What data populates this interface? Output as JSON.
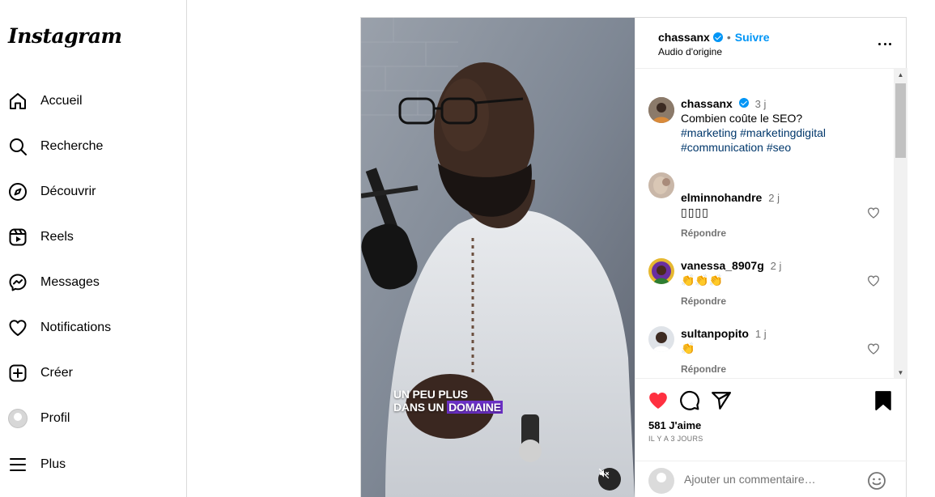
{
  "brand": {
    "logo_text": "Instagram"
  },
  "sidebar": {
    "items": [
      {
        "label": "Accueil",
        "icon": "home-icon"
      },
      {
        "label": "Recherche",
        "icon": "search-icon"
      },
      {
        "label": "Découvrir",
        "icon": "compass-icon"
      },
      {
        "label": "Reels",
        "icon": "reels-icon"
      },
      {
        "label": "Messages",
        "icon": "messenger-icon"
      },
      {
        "label": "Notifications",
        "icon": "heart-icon"
      },
      {
        "label": "Créer",
        "icon": "plus-square-icon"
      },
      {
        "label": "Profil",
        "icon": "avatar-icon"
      },
      {
        "label": "Plus",
        "icon": "menu-icon"
      }
    ]
  },
  "post": {
    "header": {
      "username": "chassanx",
      "separator": "•",
      "follow_label": "Suivre",
      "audio": "Audio d'origine"
    },
    "video_caption": {
      "line1": "UN PEU PLUS",
      "line2_prefix": "DANS UN",
      "line2_highlight": "DOMAINE"
    },
    "caption": {
      "username": "chassanx",
      "time": "3 j",
      "text": "Combien coûte le SEO?",
      "tags_line1": "#marketing #marketingdigital",
      "tags_line2": "#communication #seo"
    },
    "comments": [
      {
        "username": "elminnohandre",
        "time": "2 j",
        "text": "▯▯▯▯",
        "reply_label": "Répondre"
      },
      {
        "username": "vanessa_8907g",
        "time": "2 j",
        "text": "👏👏👏",
        "reply_label": "Répondre"
      },
      {
        "username": "sultanpopito",
        "time": "1 j",
        "text": "👏",
        "reply_label": "Répondre"
      }
    ],
    "likes": "581 J'aime",
    "date": "IL Y A 3 JOURS",
    "comment_input": {
      "placeholder": "Ajouter un commentaire…"
    },
    "colors": {
      "accent": "#0095f6",
      "like_red": "#ff3040",
      "highlight_purple": "#6a2fc5"
    }
  }
}
